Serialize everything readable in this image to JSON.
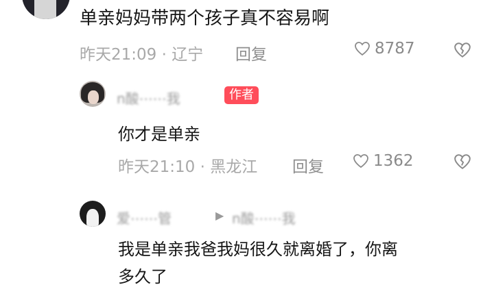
{
  "comment": {
    "text": "单亲妈妈带两个孩子真不容易啊",
    "meta": "昨天21:09 · 辽宁",
    "reply_label": "回复",
    "likes": "8787"
  },
  "replies": [
    {
      "username": "n酸⋯⋯我",
      "badge": "作者",
      "text": "你才是单亲",
      "meta": "昨天21:10 · 黑龙江",
      "reply_label": "回复",
      "likes": "1362"
    },
    {
      "username": "爱⋯⋯管",
      "reply_to": "n酸⋯⋯我",
      "text_line1": "我是单亲我爸我妈很久就离婚了，你离",
      "text_line2": "多久了"
    }
  ],
  "icons": {
    "like": "heart-outline-icon",
    "dislike": "broken-heart-icon",
    "reply_arrow": "triangle-right-icon"
  }
}
